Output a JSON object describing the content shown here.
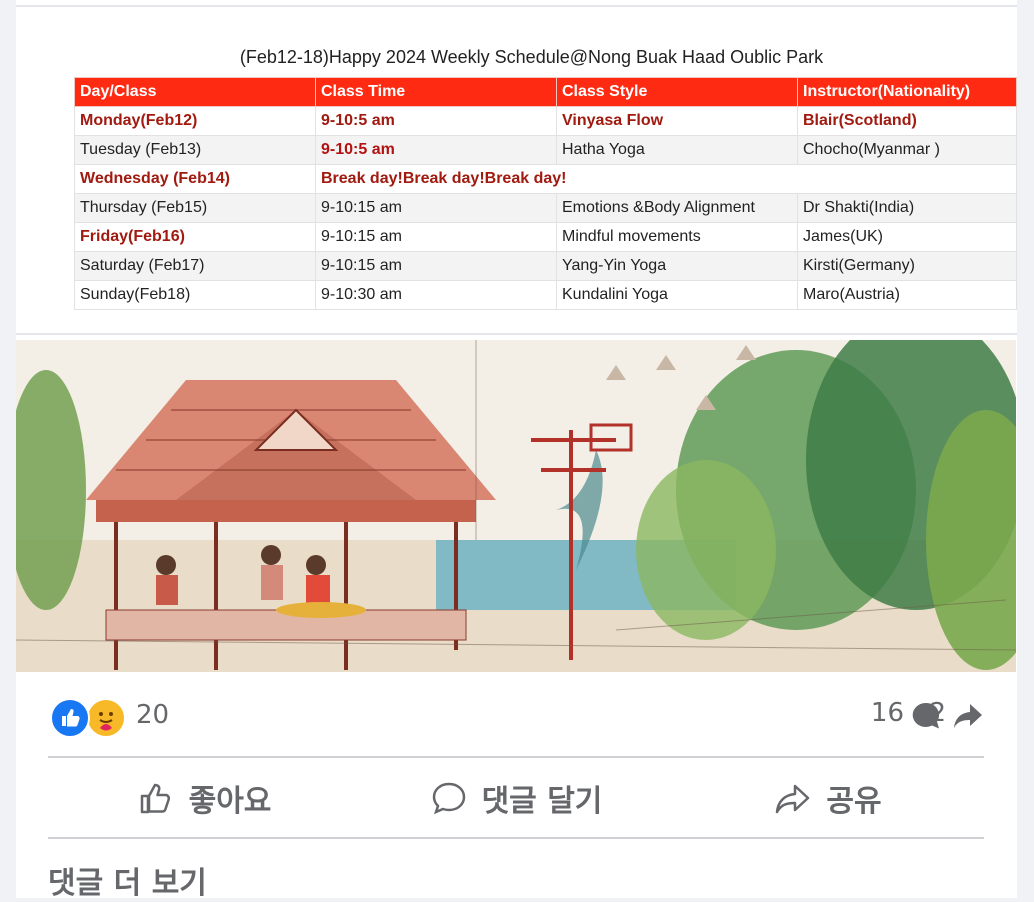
{
  "schedule": {
    "title": "(Feb12-18)Happy 2024 Weekly Schedule@Nong Buak Haad Oublic Park",
    "headers": [
      "Day/Class",
      "Class Time",
      "Class Style",
      "Instructor(Nationality)"
    ],
    "rows": [
      [
        "Monday(Feb12)",
        "9-10:5 am",
        "Vinyasa Flow",
        "Blair(Scotland)"
      ],
      [
        "Tuesday (Feb13)",
        "9-10:5 am",
        "Hatha Yoga",
        "Chocho(Myanmar )"
      ],
      [
        "Wednesday (Feb14)",
        "Break day!Break day!Break day!"
      ],
      [
        "Thursday (Feb15)",
        "9-10:15 am",
        "Emotions &Body Alignment",
        "Dr Shakti(India)"
      ],
      [
        "Friday(Feb16)",
        "9-10:15 am",
        "Mindful movements",
        "James(UK)"
      ],
      [
        "Saturday (Feb17)",
        "9-10:15 am",
        "Yang-Yin Yoga",
        "Kirsti(Germany)"
      ],
      [
        "Sunday(Feb18)",
        "9-10:30 am",
        "Kundalini Yoga",
        "Maro(Austria)"
      ]
    ]
  },
  "post": {
    "reaction_count": "20",
    "comment_count": "16",
    "share_count": "2"
  },
  "actions": {
    "like_label": "좋아요",
    "comment_label": "댓글 달기",
    "share_label": "공유"
  },
  "more_comments_label": "댓글 더 보기",
  "colors": {
    "header_red": "#ff2a12",
    "accent_text": "#a01a10",
    "like_blue": "#1877f2",
    "muted": "#65676b"
  },
  "icons": [
    "like-icon",
    "care-icon",
    "comment-icon",
    "share-icon"
  ]
}
